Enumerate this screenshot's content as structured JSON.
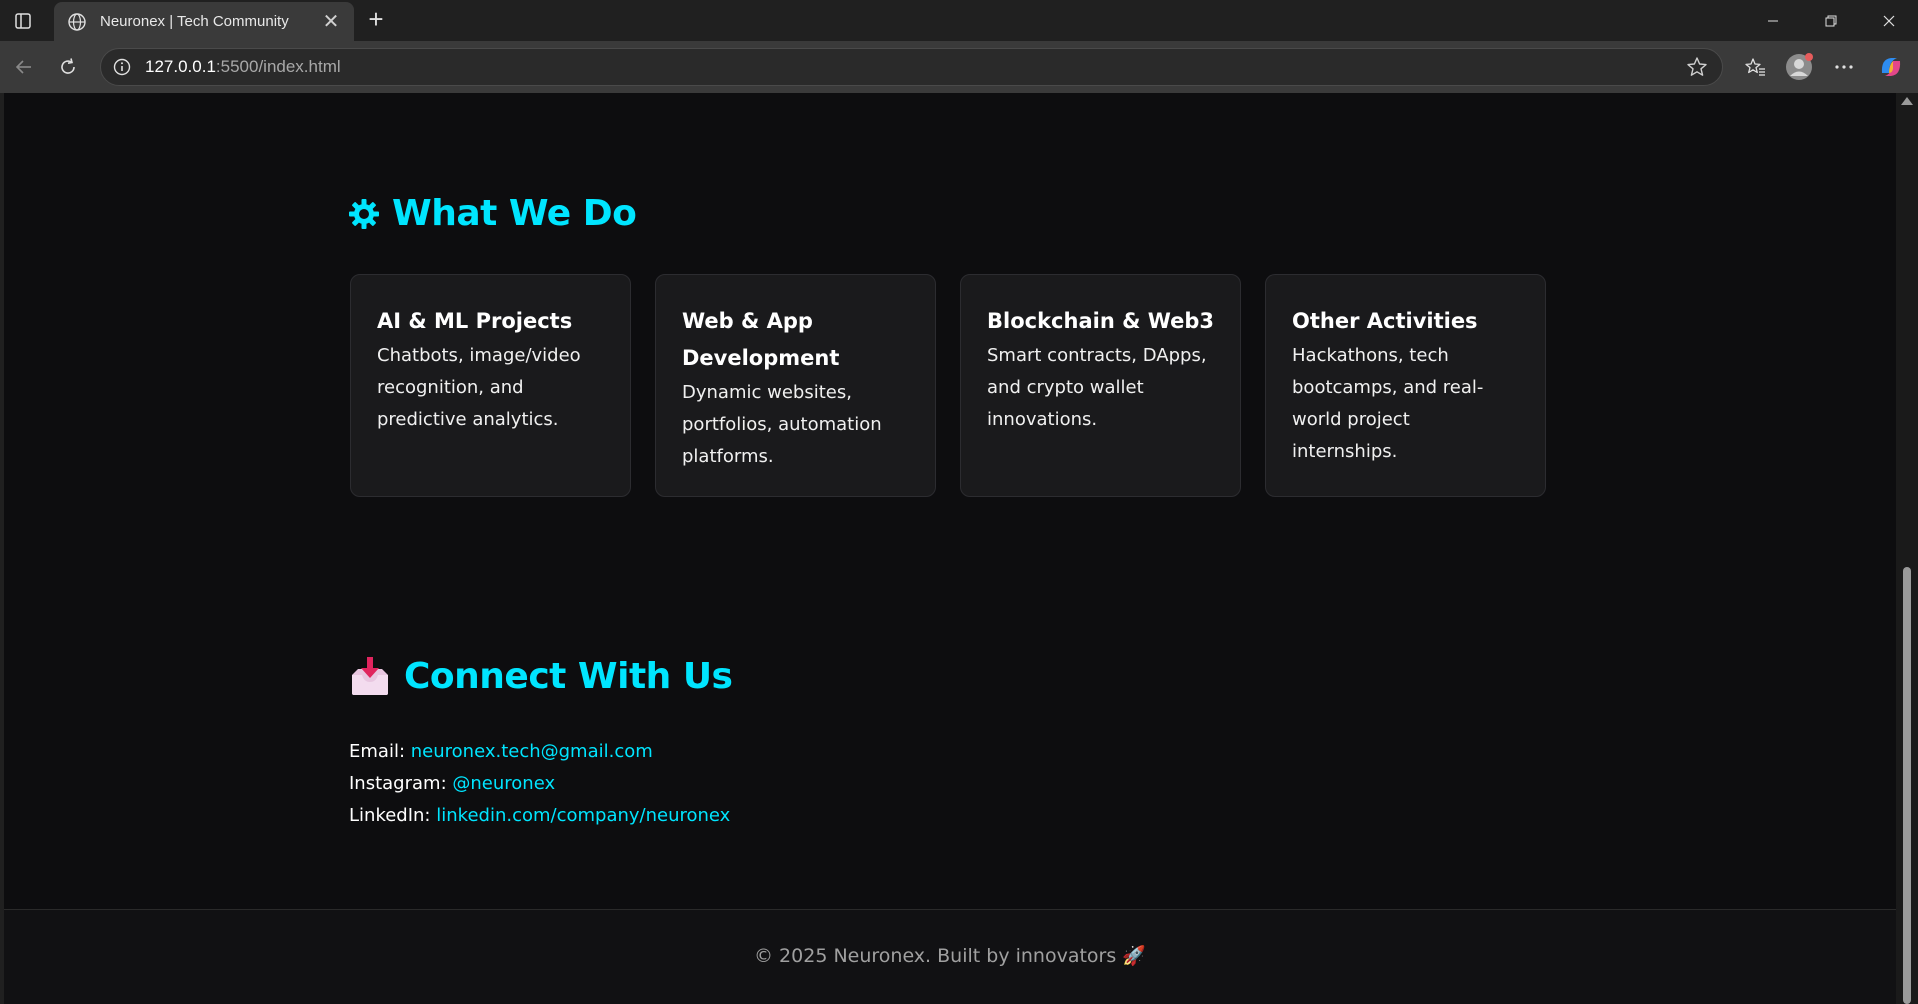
{
  "browser": {
    "tab_title": "Neuronex | Tech Community",
    "url_host": "127.0.0.1",
    "url_rest": ":5500/index.html"
  },
  "page": {
    "what_we_do": {
      "icon": "⚙",
      "title": "What We Do",
      "cards": [
        {
          "title": "AI & ML Projects",
          "text": "Chatbots, image/video recognition, and predictive analytics."
        },
        {
          "title": "Web & App Development",
          "text": "Dynamic websites, portfolios, automation platforms."
        },
        {
          "title": "Blockchain & Web3",
          "text": "Smart contracts, DApps, and crypto wallet innovations."
        },
        {
          "title": "Other Activities",
          "text": "Hackathons, tech bootcamps, and real-world project internships."
        }
      ]
    },
    "connect": {
      "icon": "inbox-tray-icon",
      "title": "Connect With Us",
      "email_label": "Email:",
      "email": "neuronex.tech@gmail.com",
      "instagram_label": "Instagram:",
      "instagram": "@neuronex",
      "linkedin_label": "LinkedIn:",
      "linkedin": "linkedin.com/company/neuronex"
    },
    "footer": {
      "text": "© 2025 Neuronex. Built by innovators 🚀"
    }
  },
  "colors": {
    "accent": "#00e5ff",
    "page_bg": "#0d0d0f",
    "card_bg": "#1a1a1c"
  }
}
